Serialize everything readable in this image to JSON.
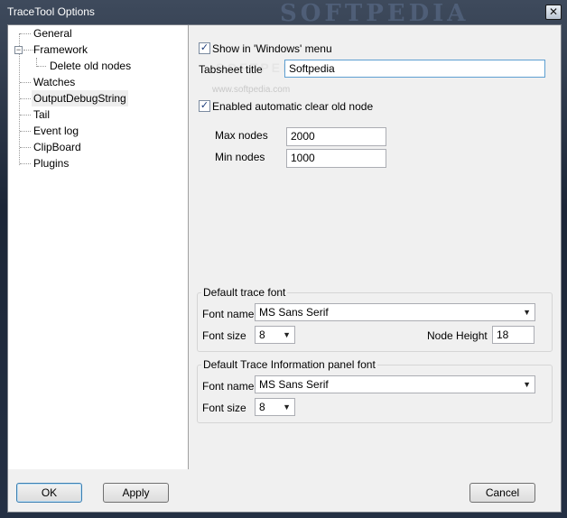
{
  "window": {
    "title": "TraceTool Options",
    "watermark": "SOFTPEDIA",
    "close_glyph": "✕"
  },
  "tree": {
    "items": [
      {
        "label": "General"
      },
      {
        "label": "Framework"
      },
      {
        "label": "Delete old nodes"
      },
      {
        "label": "Watches"
      },
      {
        "label": "OutputDebugString"
      },
      {
        "label": "Tail"
      },
      {
        "label": "Event log"
      },
      {
        "label": "ClipBoard"
      },
      {
        "label": "Plugins"
      }
    ],
    "expander_glyph": "−"
  },
  "options": {
    "show_in_windows_menu": {
      "label": "Show in 'Windows' menu",
      "checked": true
    },
    "tabsheet_title": {
      "label": "Tabsheet title",
      "value": "Softpedia"
    },
    "auto_clear": {
      "label": "Enabled automatic clear old node",
      "checked": true
    },
    "max_nodes": {
      "label": "Max nodes",
      "value": "2000"
    },
    "min_nodes": {
      "label": "Min nodes",
      "value": "1000"
    },
    "check_glyph": "✓",
    "watermark_url": "www.softpedia.com",
    "watermark_text": "SOFTPEDIA"
  },
  "trace_font": {
    "title": "Default trace font",
    "font_name_label": "Font name",
    "font_name": "MS Sans Serif",
    "font_size_label": "Font size",
    "font_size": "8",
    "node_height_label": "Node Height",
    "node_height": "18"
  },
  "info_font": {
    "title": "Default Trace Information panel font",
    "font_name_label": "Font name",
    "font_name": "MS Sans Serif",
    "font_size_label": "Font size",
    "font_size": "8"
  },
  "buttons": {
    "ok": "OK",
    "apply": "Apply",
    "cancel": "Cancel"
  },
  "arrow_glyph": "▼"
}
